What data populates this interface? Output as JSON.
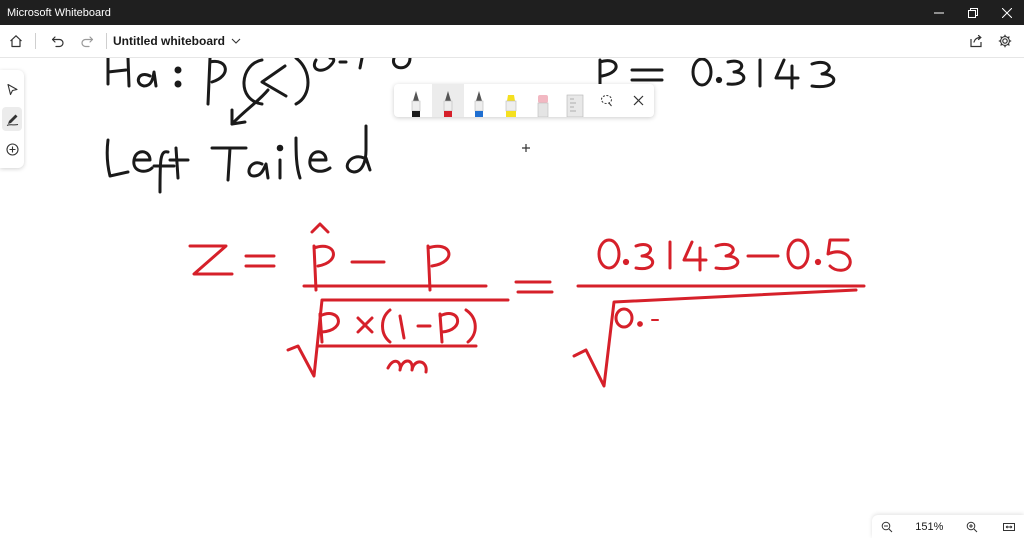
{
  "window": {
    "app_title": "Microsoft Whiteboard"
  },
  "toolbar": {
    "doc_title": "Untitled whiteboard"
  },
  "pen_tray": {
    "pens": [
      {
        "name": "black-pen",
        "color": "#1a1a1a"
      },
      {
        "name": "red-pen",
        "color": "#d6202a"
      },
      {
        "name": "blue-pen",
        "color": "#1f6fd1"
      },
      {
        "name": "highlighter-yellow",
        "color": "#f5e020"
      },
      {
        "name": "eraser",
        "color": "#f2b8c2"
      },
      {
        "name": "ruler",
        "color": "#cfcfcf"
      }
    ]
  },
  "zoom": {
    "level": "151%"
  },
  "colors": {
    "ink_black": "#1a1a1a",
    "ink_red": "#d6202a",
    "titlebar": "#1f1f1f"
  }
}
